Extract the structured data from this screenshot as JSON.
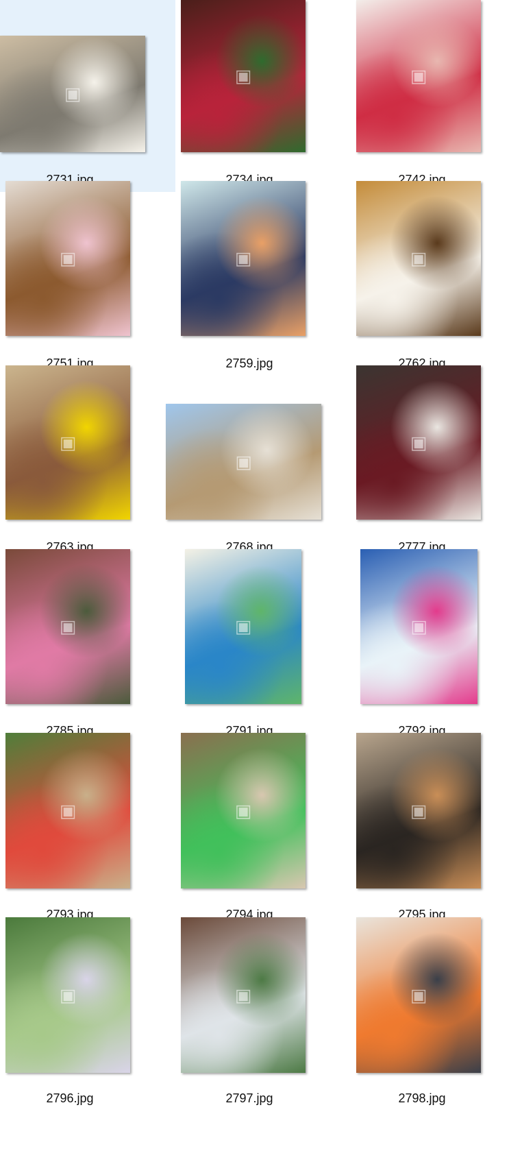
{
  "files": [
    {
      "name": "2731.jpg",
      "selected": true,
      "icon": "image-icon",
      "colors": [
        "#cdbda3",
        "#7e7a70",
        "#f5f2ea"
      ]
    },
    {
      "name": "2734.jpg",
      "selected": false,
      "icon": "image-icon",
      "colors": [
        "#4a1f1a",
        "#b8233a",
        "#2f6b2e"
      ]
    },
    {
      "name": "2742.jpg",
      "selected": false,
      "icon": "image-icon",
      "colors": [
        "#f3eeea",
        "#cf2d44",
        "#e8b7b0"
      ]
    },
    {
      "name": "2751.jpg",
      "selected": false,
      "icon": "image-icon",
      "colors": [
        "#e4dcd3",
        "#8c5a2f",
        "#efc3cf"
      ]
    },
    {
      "name": "2759.jpg",
      "selected": false,
      "icon": "image-icon",
      "colors": [
        "#cfe7e9",
        "#2b3a63",
        "#e9a066"
      ]
    },
    {
      "name": "2762.jpg",
      "selected": false,
      "icon": "image-icon",
      "colors": [
        "#c48c3a",
        "#f6f2ea",
        "#5a3a1c"
      ]
    },
    {
      "name": "2763.jpg",
      "selected": false,
      "icon": "image-icon",
      "colors": [
        "#cbb58e",
        "#8a5a3b",
        "#f1d500"
      ]
    },
    {
      "name": "2768.jpg",
      "selected": false,
      "icon": "image-icon",
      "colors": [
        "#9fc6ec",
        "#b59a73",
        "#e6e0d5"
      ]
    },
    {
      "name": "2777.jpg",
      "selected": false,
      "icon": "image-icon",
      "colors": [
        "#3b3531",
        "#6a1a23",
        "#eae6e1"
      ]
    },
    {
      "name": "2785.jpg",
      "selected": false,
      "icon": "image-icon",
      "colors": [
        "#7a4a3a",
        "#e07aa5",
        "#4c5b3c"
      ]
    },
    {
      "name": "2791.jpg",
      "selected": false,
      "icon": "image-icon",
      "colors": [
        "#f4f1e5",
        "#2a86c8",
        "#5fb56a"
      ]
    },
    {
      "name": "2792.jpg",
      "selected": false,
      "icon": "image-icon",
      "colors": [
        "#2a5fb3",
        "#e9f3f8",
        "#e33b8c"
      ]
    },
    {
      "name": "2793.jpg",
      "selected": false,
      "icon": "image-icon",
      "colors": [
        "#4f7e3a",
        "#e04a3c",
        "#c9b08a"
      ]
    },
    {
      "name": "2794.jpg",
      "selected": false,
      "icon": "image-icon",
      "colors": [
        "#8a6f4f",
        "#41c05b",
        "#d8c7b0"
      ]
    },
    {
      "name": "2795.jpg",
      "selected": false,
      "icon": "image-icon",
      "colors": [
        "#b8a58d",
        "#2a2521",
        "#c98e57"
      ]
    },
    {
      "name": "2796.jpg",
      "selected": false,
      "icon": "image-icon",
      "colors": [
        "#4b7a3c",
        "#a7c98a",
        "#d9d4e8"
      ]
    },
    {
      "name": "2797.jpg",
      "selected": false,
      "icon": "image-icon",
      "colors": [
        "#6b4a3a",
        "#dfe4e8",
        "#4d7a45"
      ]
    },
    {
      "name": "2798.jpg",
      "selected": false,
      "icon": "image-icon",
      "colors": [
        "#e9e4dc",
        "#ef7a2f",
        "#3a3f49"
      ]
    }
  ],
  "colors": {
    "selection": "#e5f1fb",
    "label": "#111111"
  }
}
